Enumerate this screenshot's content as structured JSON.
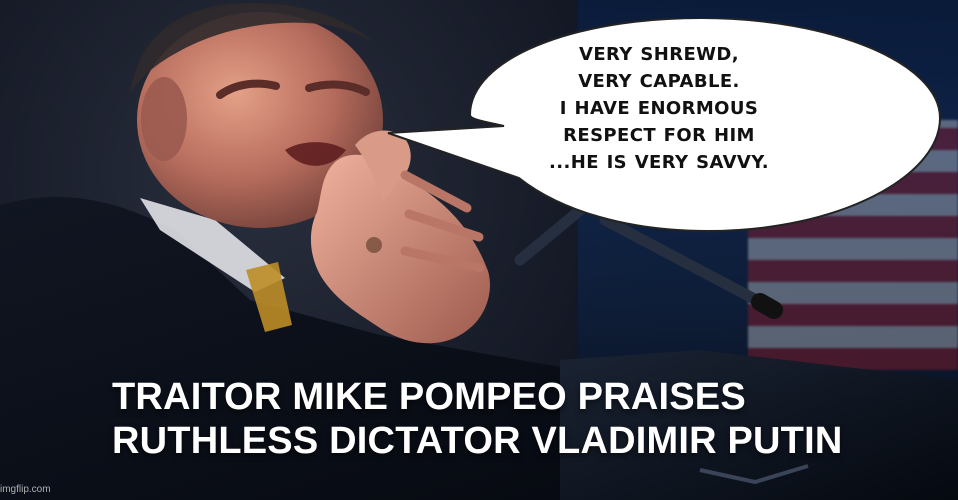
{
  "meme": {
    "quote_lines": [
      "VERY SHREWD,",
      "VERY CAPABLE.",
      "I HAVE ENORMOUS",
      "RESPECT FOR HIM",
      "...HE IS VERY SAVVY."
    ],
    "caption_lines": [
      "TRAITOR MIKE POMPEO PRAISES",
      "RUTHLESS DICTATOR VLADIMIR PUTIN"
    ],
    "watermark": "imgflip.com"
  }
}
